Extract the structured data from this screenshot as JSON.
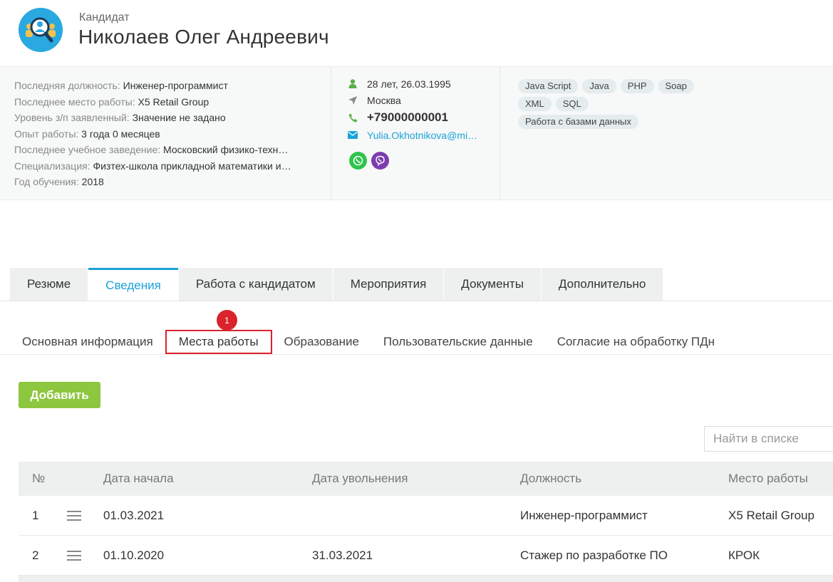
{
  "header": {
    "kind": "Кандидат",
    "name": "Николаев Олег Андреевич"
  },
  "info": {
    "rows": [
      {
        "label": "Последняя должность:",
        "value": "Инженер-программист"
      },
      {
        "label": "Последнее место работы:",
        "value": "X5 Retail Group"
      },
      {
        "label": "Уровень з/п заявленный:",
        "value": "Значение не задано"
      },
      {
        "label": "Опыт работы:",
        "value": "3 года 0 месяцев"
      },
      {
        "label": "Последнее учебное заведение:",
        "value": "Московский физико-техн…"
      },
      {
        "label": "Специализация:",
        "value": "Физтех-школа прикладной математики и…"
      },
      {
        "label": "Год обучения:",
        "value": "2018"
      }
    ],
    "contacts": {
      "age": "28 лет, 26.03.1995",
      "city": "Москва",
      "phone": "+79000000001",
      "email": "Yulia.Okhotnikova@mi…"
    },
    "skills": [
      "Java Script",
      "Java",
      "PHP",
      "Soap",
      "XML",
      "SQL",
      "Работа с базами данных"
    ]
  },
  "tabs": [
    "Резюме",
    "Сведения",
    "Работа с кандидатом",
    "Мероприятия",
    "Документы",
    "Дополнительно"
  ],
  "subtabs": [
    "Основная информация",
    "Места работы",
    "Образование",
    "Пользовательские данные",
    "Согласие на обработку ПДн"
  ],
  "marker": "1",
  "actions": {
    "add_label": "Добавить",
    "search_placeholder": "Найти в списке"
  },
  "table": {
    "headers": [
      "№",
      "Дата начала",
      "Дата увольнения",
      "Должность",
      "Место работы"
    ],
    "rows": [
      {
        "num": "1",
        "start": "01.03.2021",
        "end": "",
        "position": "Инженер-программист",
        "place": "X5 Retail Group"
      },
      {
        "num": "2",
        "start": "01.10.2020",
        "end": "31.03.2021",
        "position": "Стажер по разработке ПО",
        "place": "КРОК"
      }
    ]
  },
  "colors": {
    "accent": "#1aa3d9",
    "add_button": "#8dc63f",
    "highlight": "#d9232d"
  }
}
